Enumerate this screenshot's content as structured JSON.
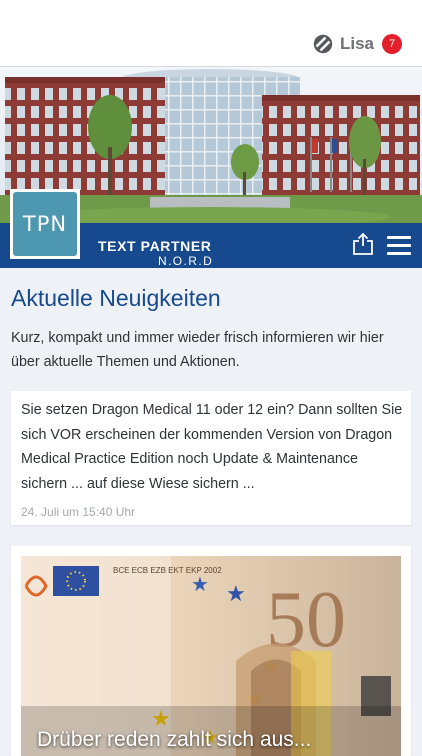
{
  "header": {
    "user_name": "Lisa",
    "notification_count": "7",
    "user_icon": "segmented-circle-icon"
  },
  "brand": {
    "logo_text": "TPN",
    "line1": "TEXT PARTNER",
    "line2": "N.O.R.D",
    "share_icon": "share-icon",
    "menu_icon": "hamburger-menu-icon",
    "bar_color": "#16498e"
  },
  "main": {
    "title": "Aktuelle Neuigkeiten",
    "intro": "Kurz, kompakt und immer wieder frisch informieren wir hier über aktuelle Themen und Aktionen.",
    "posts": [
      {
        "text": "Sie setzen Dragon Medical 11 oder 12 ein? Dann sollten Sie sich VOR erscheinen der kommenden Version von Dragon Medical Practice Edition noch Update & Maintenance sichern ... auf diese Wiese sichern ...",
        "date": "24. Juli um 15:40 Uhr"
      },
      {
        "title": "Drüber reden zahlt sich aus...",
        "image_label": "50",
        "image_caption": "BCE ECB EZB EKT EKP 2002"
      }
    ]
  },
  "colors": {
    "accent": "#16498e",
    "badge": "#e3202a",
    "background": "#eef1f6"
  }
}
